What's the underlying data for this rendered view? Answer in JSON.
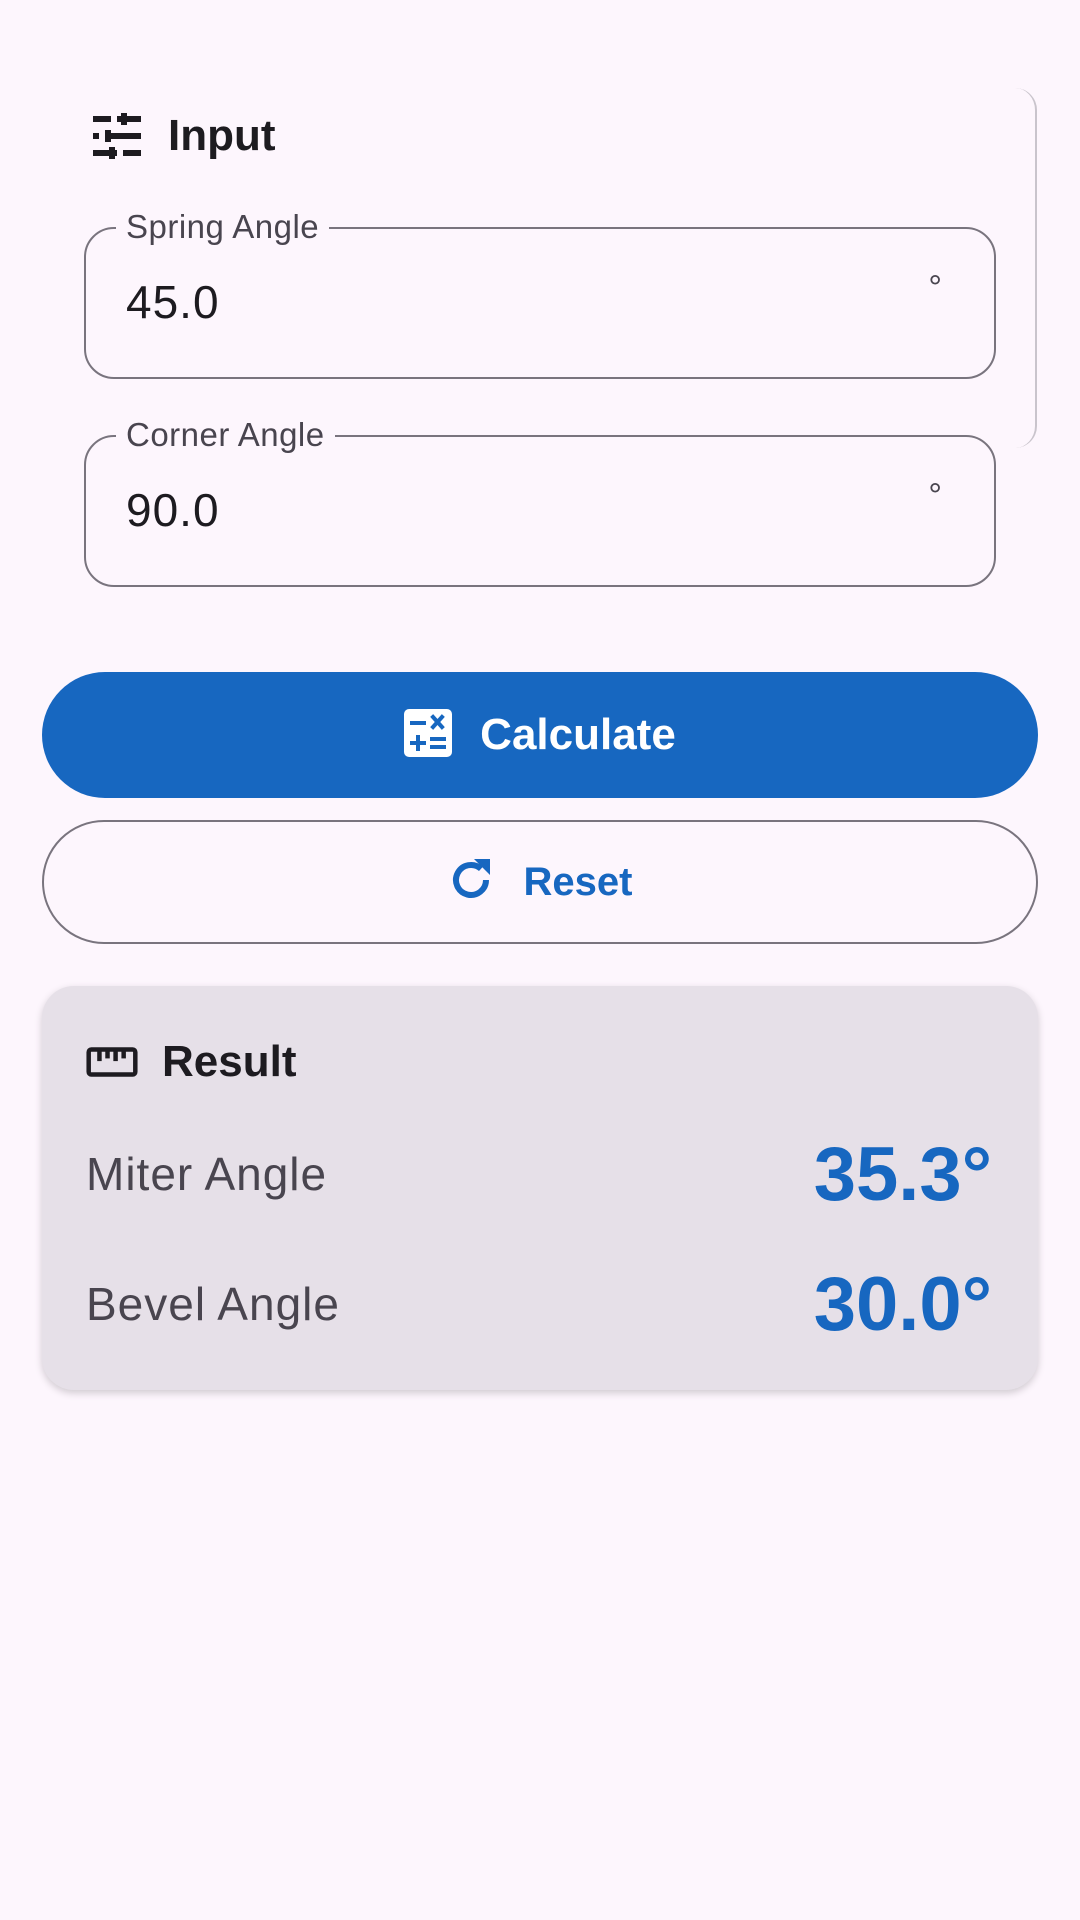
{
  "input_section": {
    "title": "Input",
    "icon": "tune-sliders-icon",
    "fields": [
      {
        "label": "Spring Angle",
        "value": "45.0",
        "suffix": "°"
      },
      {
        "label": "Corner Angle",
        "value": "90.0",
        "suffix": "°"
      }
    ]
  },
  "actions": {
    "calculate_label": "Calculate",
    "calculate_icon": "calculator-icon",
    "reset_label": "Reset",
    "reset_icon": "refresh-icon"
  },
  "result_section": {
    "title": "Result",
    "icon": "ruler-icon",
    "rows": [
      {
        "label": "Miter Angle",
        "value": "35.3°"
      },
      {
        "label": "Bevel Angle",
        "value": "30.0°"
      }
    ]
  },
  "colors": {
    "background": "#fdf6fd",
    "primary": "#1767c0",
    "outline": "#79747e",
    "result_card": "#e6e0e8",
    "text": "#1d1b20"
  }
}
